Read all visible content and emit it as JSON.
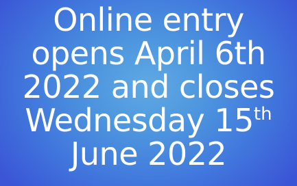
{
  "banner": {
    "line1": "Online entry",
    "line2": "opens April 6th",
    "line3": "2022 and closes",
    "line4_main": "Wednesday 15",
    "line4_superscript": "th",
    "line5": "June 2022"
  },
  "colors": {
    "background_center": "#5fa9e4",
    "background_edge": "#3b55d6",
    "text": "#ffffff"
  }
}
